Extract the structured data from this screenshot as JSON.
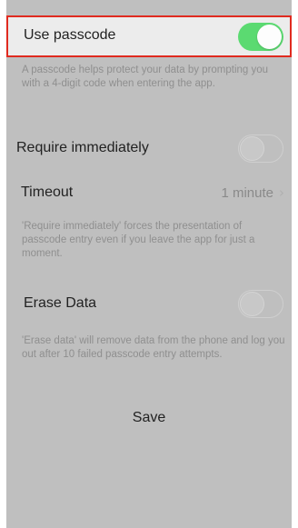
{
  "passcode": {
    "label": "Use passcode",
    "toggle_on": true,
    "help": "A passcode helps protect your data by prompting you with a 4-digit code when entering the app."
  },
  "require_immediately": {
    "label": "Require immediately",
    "toggle_on": false
  },
  "timeout": {
    "label": "Timeout",
    "value": "1 minute",
    "chevron": "chevron-right-icon"
  },
  "require_help": "'Require immediately' forces the presentation of passcode entry even if you leave the app for just a moment.",
  "erase": {
    "label": "Erase Data",
    "toggle_on": false,
    "help": "'Erase data' will remove data from the phone and log you out after 10 failed passcode entry attempts."
  },
  "save_label": "Save",
  "colors": {
    "toggle_on": "#4cd964",
    "highlight_border": "#e02a1f",
    "background": "#bfbfbf"
  }
}
